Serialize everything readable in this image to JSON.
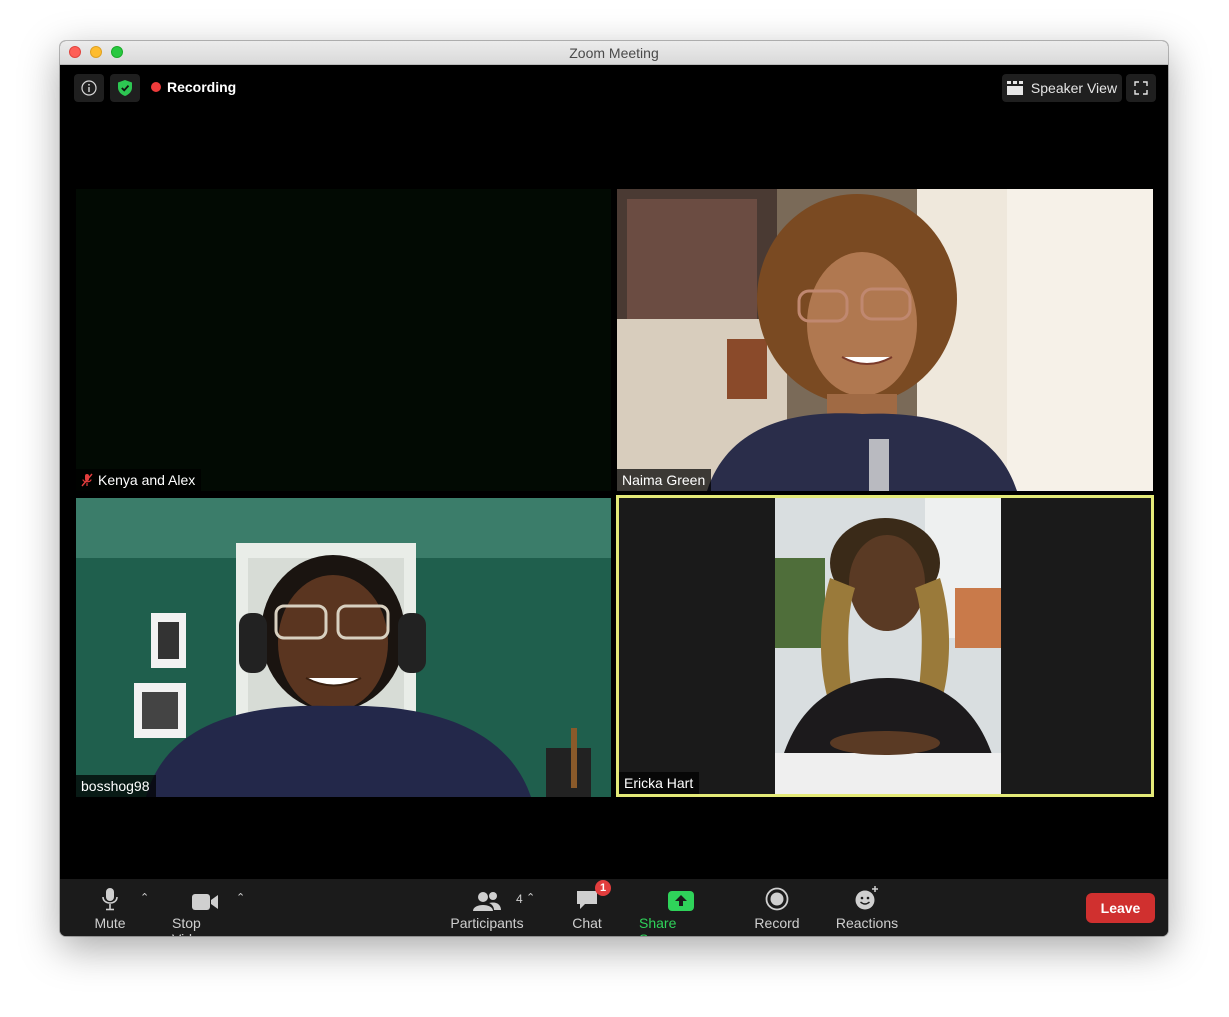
{
  "window": {
    "title": "Zoom Meeting"
  },
  "topbar": {
    "recording_label": "Recording",
    "view_label": "Speaker View"
  },
  "participants": [
    {
      "name": "Kenya and Alex",
      "muted": true,
      "video": "off"
    },
    {
      "name": "Naima Green",
      "muted": false,
      "video": "on"
    },
    {
      "name": "bosshog98",
      "muted": false,
      "video": "on"
    },
    {
      "name": "Ericka Hart",
      "muted": false,
      "video": "on",
      "active_speaker": true
    }
  ],
  "toolbar": {
    "mute_label": "Mute",
    "video_label": "Stop Video",
    "participants_label": "Participants",
    "participants_count": "4",
    "chat_label": "Chat",
    "chat_badge": "1",
    "share_label": "Share Screen",
    "record_label": "Record",
    "reactions_label": "Reactions",
    "leave_label": "Leave"
  },
  "colors": {
    "share_green": "#2fd35a",
    "leave_red": "#d0302f",
    "recording_red": "#ee3b3b",
    "active_speaker_border": "#e4ea78"
  }
}
